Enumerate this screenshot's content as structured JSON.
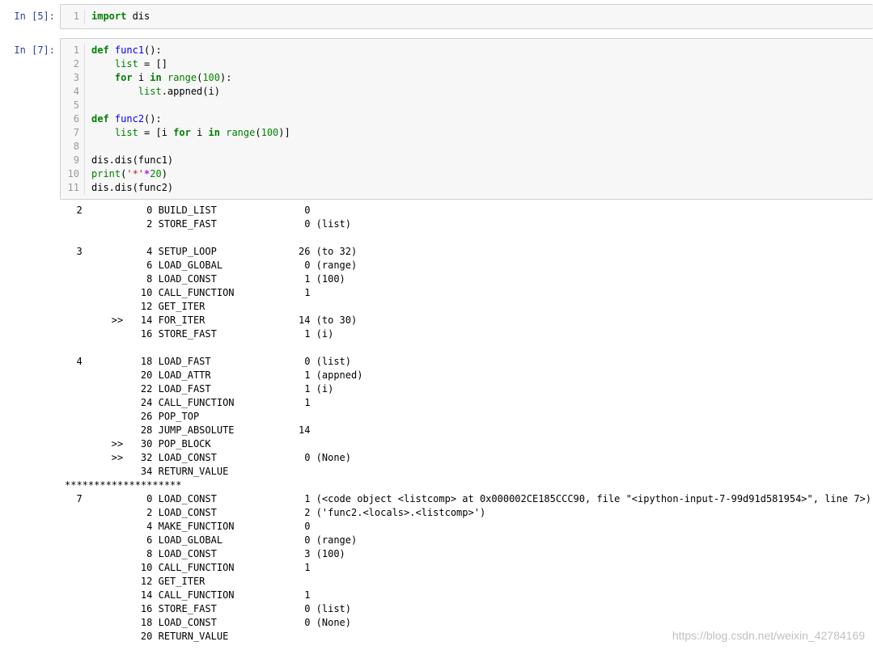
{
  "cells": [
    {
      "prompt": "In  [5]:",
      "lines": [
        {
          "no": "1",
          "parts": [
            {
              "t": "import",
              "c": "kw"
            },
            {
              "t": " dis",
              "c": ""
            }
          ]
        }
      ]
    },
    {
      "prompt": "In  [7]:",
      "lines": [
        {
          "no": "1",
          "parts": [
            {
              "t": "def",
              "c": "kw"
            },
            {
              "t": " ",
              "c": ""
            },
            {
              "t": "func1",
              "c": "fn"
            },
            {
              "t": "():",
              "c": ""
            }
          ]
        },
        {
          "no": "2",
          "parts": [
            {
              "t": "    ",
              "c": ""
            },
            {
              "t": "list",
              "c": "bi"
            },
            {
              "t": " = []",
              "c": ""
            }
          ]
        },
        {
          "no": "3",
          "parts": [
            {
              "t": "    ",
              "c": ""
            },
            {
              "t": "for",
              "c": "kw"
            },
            {
              "t": " i ",
              "c": ""
            },
            {
              "t": "in",
              "c": "kw"
            },
            {
              "t": " ",
              "c": ""
            },
            {
              "t": "range",
              "c": "bi"
            },
            {
              "t": "(",
              "c": ""
            },
            {
              "t": "100",
              "c": "num"
            },
            {
              "t": "):",
              "c": ""
            }
          ]
        },
        {
          "no": "4",
          "parts": [
            {
              "t": "        ",
              "c": ""
            },
            {
              "t": "list",
              "c": "bi"
            },
            {
              "t": ".appned(i)",
              "c": ""
            }
          ]
        },
        {
          "no": "5",
          "parts": []
        },
        {
          "no": "6",
          "parts": [
            {
              "t": "def",
              "c": "kw"
            },
            {
              "t": " ",
              "c": ""
            },
            {
              "t": "func2",
              "c": "fn"
            },
            {
              "t": "():",
              "c": ""
            }
          ]
        },
        {
          "no": "7",
          "parts": [
            {
              "t": "    ",
              "c": ""
            },
            {
              "t": "list",
              "c": "bi"
            },
            {
              "t": " = [i ",
              "c": ""
            },
            {
              "t": "for",
              "c": "kw"
            },
            {
              "t": " i ",
              "c": ""
            },
            {
              "t": "in",
              "c": "kw"
            },
            {
              "t": " ",
              "c": ""
            },
            {
              "t": "range",
              "c": "bi"
            },
            {
              "t": "(",
              "c": ""
            },
            {
              "t": "100",
              "c": "num"
            },
            {
              "t": ")]",
              "c": ""
            }
          ]
        },
        {
          "no": "8",
          "parts": []
        },
        {
          "no": "9",
          "parts": [
            {
              "t": "dis.dis(func1)",
              "c": ""
            }
          ]
        },
        {
          "no": "10",
          "parts": [
            {
              "t": "print",
              "c": "bi"
            },
            {
              "t": "(",
              "c": ""
            },
            {
              "t": "'*'",
              "c": "str"
            },
            {
              "t": "*",
              "c": "op"
            },
            {
              "t": "20",
              "c": "num"
            },
            {
              "t": ")",
              "c": ""
            }
          ]
        },
        {
          "no": "11",
          "parts": [
            {
              "t": "dis.dis(func2)",
              "c": ""
            }
          ]
        }
      ]
    }
  ],
  "output": [
    "  2           0 BUILD_LIST               0",
    "              2 STORE_FAST               0 (list)",
    "",
    "  3           4 SETUP_LOOP              26 (to 32)",
    "              6 LOAD_GLOBAL              0 (range)",
    "              8 LOAD_CONST               1 (100)",
    "             10 CALL_FUNCTION            1",
    "             12 GET_ITER",
    "        >>   14 FOR_ITER                14 (to 30)",
    "             16 STORE_FAST               1 (i)",
    "",
    "  4          18 LOAD_FAST                0 (list)",
    "             20 LOAD_ATTR                1 (appned)",
    "             22 LOAD_FAST                1 (i)",
    "             24 CALL_FUNCTION            1",
    "             26 POP_TOP",
    "             28 JUMP_ABSOLUTE           14",
    "        >>   30 POP_BLOCK",
    "        >>   32 LOAD_CONST               0 (None)",
    "             34 RETURN_VALUE",
    "********************",
    "  7           0 LOAD_CONST               1 (<code object <listcomp> at 0x000002CE185CCC90, file \"<ipython-input-7-99d91d581954>\", line 7>)",
    "              2 LOAD_CONST               2 ('func2.<locals>.<listcomp>')",
    "              4 MAKE_FUNCTION            0",
    "              6 LOAD_GLOBAL              0 (range)",
    "              8 LOAD_CONST               3 (100)",
    "             10 CALL_FUNCTION            1",
    "             12 GET_ITER",
    "             14 CALL_FUNCTION            1",
    "             16 STORE_FAST               0 (list)",
    "             18 LOAD_CONST               0 (None)",
    "             20 RETURN_VALUE"
  ],
  "watermark": "https://blog.csdn.net/weixin_42784169"
}
